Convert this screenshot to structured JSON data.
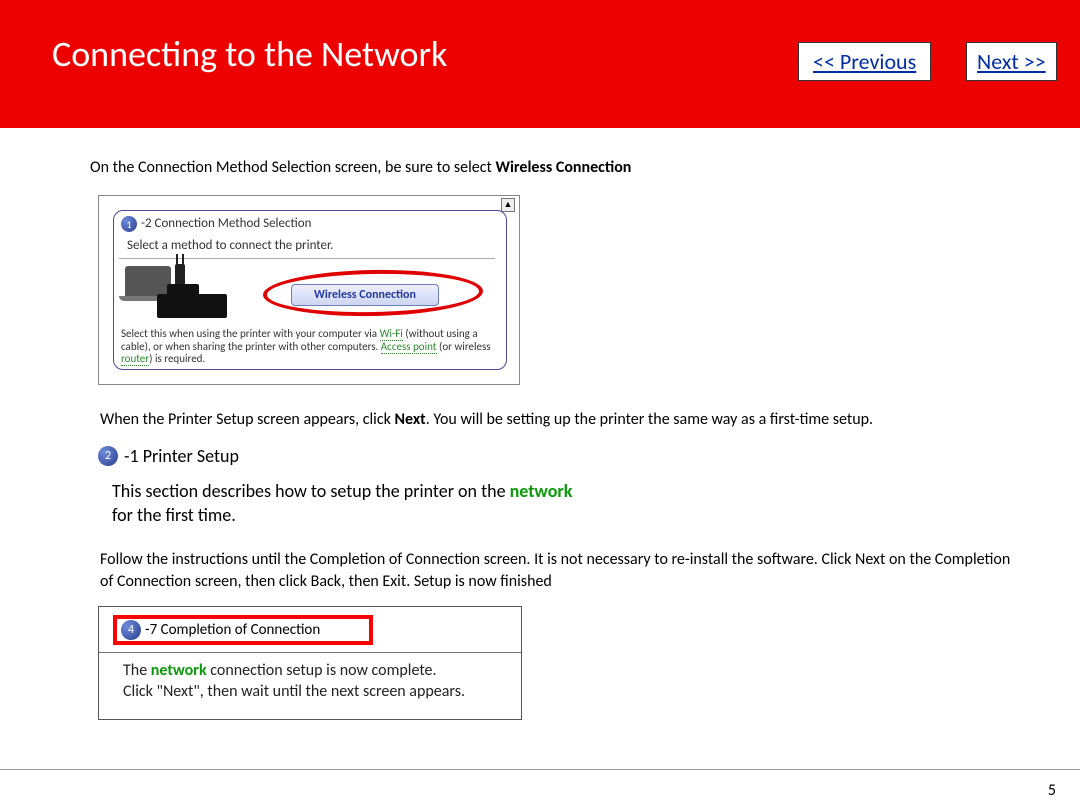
{
  "header": {
    "title": "Connecting to the Network",
    "prev_label": "<< Previous",
    "next_label": "Next >>"
  },
  "intro": {
    "prefix": "On the Connection Method Selection screen, be sure to select ",
    "bold": "Wireless Connection"
  },
  "shot1": {
    "badge": "1",
    "step_suffix": "-2 Connection Method Selection",
    "subtitle": "Select a method to connect the printer.",
    "button": "Wireless Connection",
    "desc_p1": "Select this when using the printer with your computer via ",
    "wifi": "Wi-Fi",
    "desc_p2": " (without using a cable), or when sharing the printer with other computers. ",
    "ap": "Access point",
    "desc_p3": " (or wireless ",
    "router": "router",
    "desc_p4": ") is required."
  },
  "para2": {
    "p1": "When the Printer Setup screen appears, click ",
    "bold": "Next",
    "p2": ". You will be setting up the printer the same way as a first-time setup."
  },
  "ps": {
    "badge": "2",
    "title_suffix": "-1 Printer Setup",
    "body1": "This section describes how to setup the printer on the ",
    "green": "network",
    "body2": " for the first time."
  },
  "para3": "Follow the instructions until the Completion of Connection screen.  It is not necessary to re-install the software. Click Next on the Completion of Connection screen, then click Back, then Exit.  Setup is now finished",
  "shot3": {
    "badge": "4",
    "title_suffix": "-7 Completion of Connection",
    "body1a": "The ",
    "green": "network",
    "body1b": " connection setup is now complete.",
    "body2": "Click \"Next\", then wait until the next screen appears."
  },
  "page_number": "5"
}
